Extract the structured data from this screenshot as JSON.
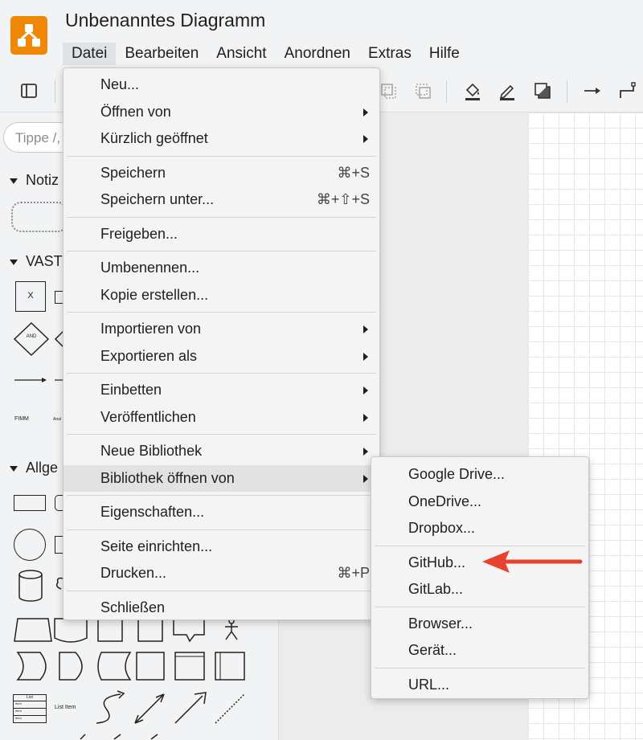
{
  "app": {
    "title": "Unbenanntes Diagramm",
    "brand_color": "#f08705"
  },
  "menubar": [
    "Datei",
    "Bearbeiten",
    "Ansicht",
    "Anordnen",
    "Extras",
    "Hilfe"
  ],
  "sidebar": {
    "search_placeholder": "Tippe /,",
    "sections": [
      "Notiz",
      "VAST",
      "Allge"
    ],
    "shape_labels": {
      "x": "X",
      "and": "AND",
      "fimm": "FIMM",
      "anal": "Anal",
      "list_item": "List Item",
      "list": "List",
      "item": "Item"
    }
  },
  "file_menu": {
    "groups": [
      [
        {
          "label": "Neu...",
          "shortcut": "",
          "submenu": false
        },
        {
          "label": "Öffnen von",
          "shortcut": "",
          "submenu": true
        },
        {
          "label": "Kürzlich geöffnet",
          "shortcut": "",
          "submenu": true
        }
      ],
      [
        {
          "label": "Speichern",
          "shortcut": "⌘+S",
          "submenu": false
        },
        {
          "label": "Speichern unter...",
          "shortcut": "⌘+⇧+S",
          "submenu": false
        }
      ],
      [
        {
          "label": "Freigeben...",
          "shortcut": "",
          "submenu": false
        }
      ],
      [
        {
          "label": "Umbenennen...",
          "shortcut": "",
          "submenu": false
        },
        {
          "label": "Kopie erstellen...",
          "shortcut": "",
          "submenu": false
        }
      ],
      [
        {
          "label": "Importieren von",
          "shortcut": "",
          "submenu": true
        },
        {
          "label": "Exportieren als",
          "shortcut": "",
          "submenu": true
        }
      ],
      [
        {
          "label": "Einbetten",
          "shortcut": "",
          "submenu": true
        },
        {
          "label": "Veröffentlichen",
          "shortcut": "",
          "submenu": true
        }
      ],
      [
        {
          "label": "Neue Bibliothek",
          "shortcut": "",
          "submenu": true
        },
        {
          "label": "Bibliothek öffnen von",
          "shortcut": "",
          "submenu": true,
          "highlighted": true
        }
      ],
      [
        {
          "label": "Eigenschaften...",
          "shortcut": "",
          "submenu": false
        }
      ],
      [
        {
          "label": "Seite einrichten...",
          "shortcut": "",
          "submenu": false
        },
        {
          "label": "Drucken...",
          "shortcut": "⌘+P",
          "submenu": false
        }
      ],
      [
        {
          "label": "Schließen",
          "shortcut": "",
          "submenu": false
        }
      ]
    ]
  },
  "library_submenu": {
    "groups": [
      [
        "Google Drive...",
        "OneDrive...",
        "Dropbox..."
      ],
      [
        "GitHub...",
        "GitLab..."
      ],
      [
        "Browser...",
        "Gerät..."
      ],
      [
        "URL..."
      ]
    ]
  },
  "annotation": {
    "color": "#e8412f",
    "points_to": "GitHub..."
  }
}
